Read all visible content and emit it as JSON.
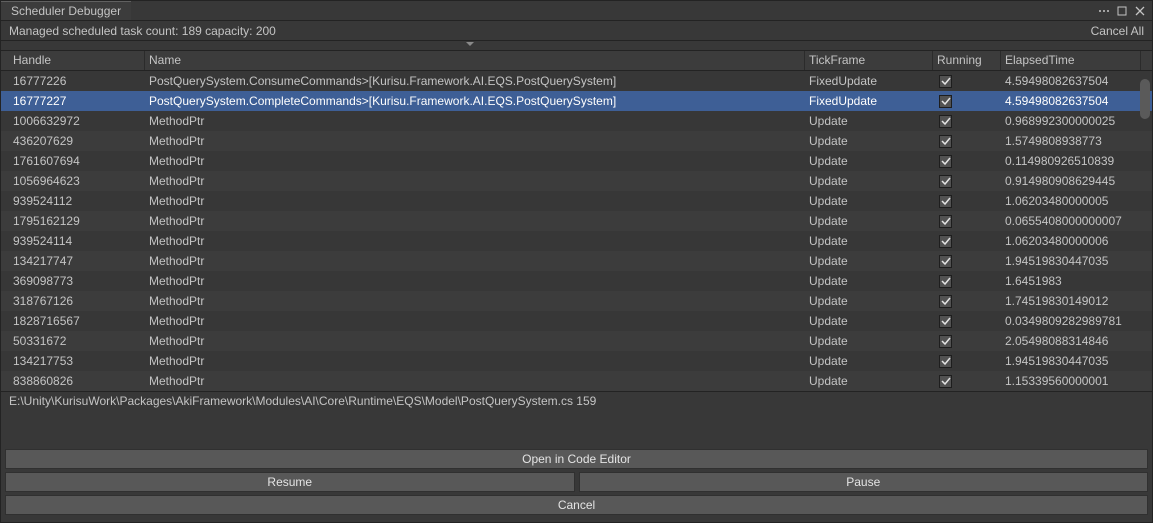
{
  "title": "Scheduler Debugger",
  "info": "Managed scheduled task count: 189 capacity: 200",
  "cancelAll": "Cancel All",
  "columns": {
    "handle": "Handle",
    "name": "Name",
    "tick": "TickFrame",
    "running": "Running",
    "elapsed": "ElapsedTime"
  },
  "rows": [
    {
      "handle": "16777226",
      "name": "PostQuerySystem.ConsumeCommands>[Kurisu.Framework.AI.EQS.PostQuerySystem]",
      "tick": "FixedUpdate",
      "running": true,
      "elapsed": "4.59498082637504",
      "selected": false
    },
    {
      "handle": "16777227",
      "name": "PostQuerySystem.CompleteCommands>[Kurisu.Framework.AI.EQS.PostQuerySystem]",
      "tick": "FixedUpdate",
      "running": true,
      "elapsed": "4.59498082637504",
      "selected": true
    },
    {
      "handle": "1006632972",
      "name": "MethodPtr",
      "tick": "Update",
      "running": true,
      "elapsed": "0.968992300000025",
      "selected": false
    },
    {
      "handle": "436207629",
      "name": "MethodPtr",
      "tick": "Update",
      "running": true,
      "elapsed": "1.5749808938773",
      "selected": false
    },
    {
      "handle": "1761607694",
      "name": "MethodPtr",
      "tick": "Update",
      "running": true,
      "elapsed": "0.114980926510839",
      "selected": false
    },
    {
      "handle": "1056964623",
      "name": "MethodPtr",
      "tick": "Update",
      "running": true,
      "elapsed": "0.914980908629445",
      "selected": false
    },
    {
      "handle": "939524112",
      "name": "MethodPtr",
      "tick": "Update",
      "running": true,
      "elapsed": "1.06203480000005",
      "selected": false
    },
    {
      "handle": "1795162129",
      "name": "MethodPtr",
      "tick": "Update",
      "running": true,
      "elapsed": "0.0655408000000007",
      "selected": false
    },
    {
      "handle": "939524114",
      "name": "MethodPtr",
      "tick": "Update",
      "running": true,
      "elapsed": "1.06203480000006",
      "selected": false
    },
    {
      "handle": "134217747",
      "name": "MethodPtr",
      "tick": "Update",
      "running": true,
      "elapsed": "1.94519830447035",
      "selected": false
    },
    {
      "handle": "369098773",
      "name": "MethodPtr",
      "tick": "Update",
      "running": true,
      "elapsed": "1.6451983",
      "selected": false
    },
    {
      "handle": "318767126",
      "name": "MethodPtr",
      "tick": "Update",
      "running": true,
      "elapsed": "1.74519830149012",
      "selected": false
    },
    {
      "handle": "1828716567",
      "name": "MethodPtr",
      "tick": "Update",
      "running": true,
      "elapsed": "0.0349809282989781",
      "selected": false
    },
    {
      "handle": "50331672",
      "name": "MethodPtr",
      "tick": "Update",
      "running": true,
      "elapsed": "2.05498088314846",
      "selected": false
    },
    {
      "handle": "134217753",
      "name": "MethodPtr",
      "tick": "Update",
      "running": true,
      "elapsed": "1.94519830447035",
      "selected": false
    },
    {
      "handle": "838860826",
      "name": "MethodPtr",
      "tick": "Update",
      "running": true,
      "elapsed": "1.15339560000001",
      "selected": false
    }
  ],
  "path": "E:\\Unity\\KurisuWork\\Packages\\AkiFramework\\Modules\\AI\\Core\\Runtime\\EQS\\Model\\PostQuerySystem.cs 159",
  "buttons": {
    "open": "Open in Code Editor",
    "resume": "Resume",
    "pause": "Pause",
    "cancel": "Cancel"
  }
}
